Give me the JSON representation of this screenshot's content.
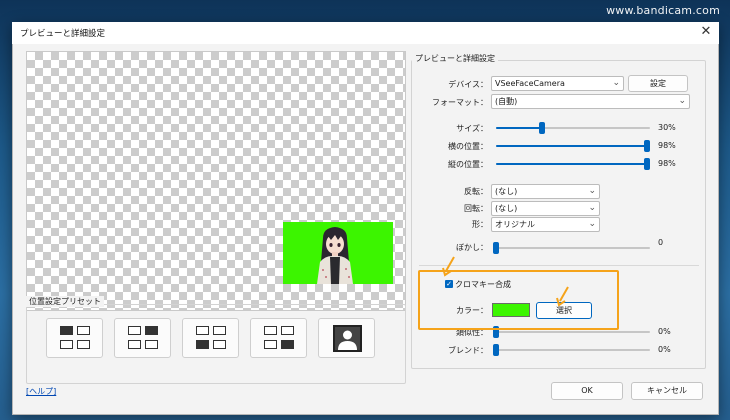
{
  "watermark": "www.bandicam.com",
  "dialog": {
    "title": "プレビューと詳細設定",
    "close_glyph": "✕"
  },
  "settings": {
    "group_title": "プレビューと詳細設定",
    "device": {
      "label": "デバイス：",
      "value": "VSeeFaceCamera",
      "button": "設定"
    },
    "format": {
      "label": "フォーマット：",
      "value": "(自動)"
    },
    "size": {
      "label": "サイズ：",
      "value": "30%",
      "level": 0.3
    },
    "horizontal": {
      "label": "横の位置：",
      "value": "98%",
      "level": 0.98
    },
    "vertical": {
      "label": "縦の位置：",
      "value": "98%",
      "level": 0.98
    },
    "flip": {
      "label": "反転：",
      "value": "(なし)"
    },
    "rotate": {
      "label": "回転：",
      "value": "(なし)"
    },
    "shape": {
      "label": "形：",
      "value": "オリジナル"
    },
    "blur": {
      "label": "ぼかし：",
      "value": "0",
      "level": 0
    },
    "chroma": {
      "label": "クロマキー合成",
      "checked": true
    },
    "color": {
      "label": "カラー：",
      "swatch": "#3cf500",
      "button": "選択"
    },
    "similarity": {
      "label": "類似性：",
      "value": "0%",
      "level": 0
    },
    "blend": {
      "label": "ブレンド：",
      "value": "0%",
      "level": 0
    }
  },
  "presets": {
    "group_title": "位置設定プリセット",
    "items": [
      "top-left",
      "top-right",
      "bottom-left",
      "bottom-right",
      "full-screen"
    ]
  },
  "footer": {
    "help_link": "[ヘルプ]",
    "ok_button": "OK",
    "cancel_button": "キャンセル"
  },
  "colors": {
    "accent": "#0067c0",
    "highlight": "#f5a31a",
    "chroma_green": "#3cf500"
  },
  "icons": {
    "close": "close-icon",
    "chevron": "chevron-down-icon",
    "person": "person-icon",
    "annotation_arrow": "arrow-annotation-icon"
  }
}
